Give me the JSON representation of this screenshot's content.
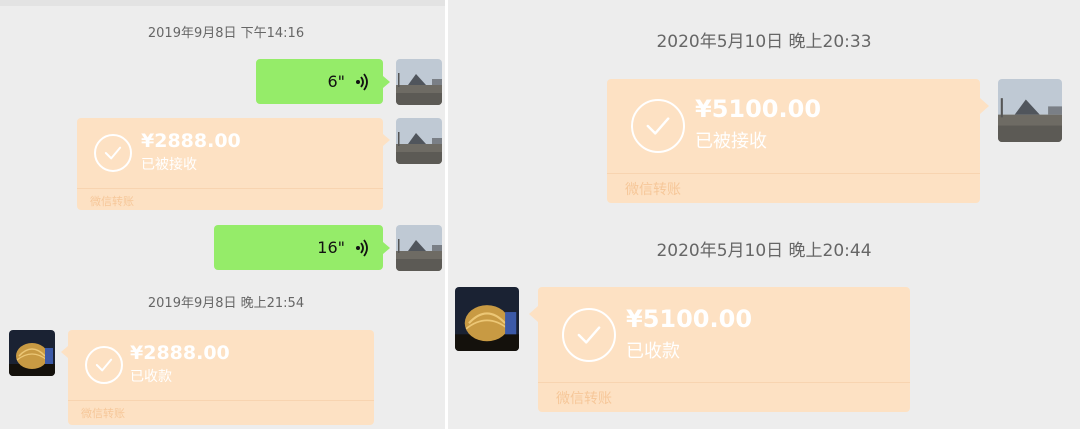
{
  "left": {
    "timestamp_1": "2019年9月8日 下午14:16",
    "voice_1": {
      "duration": "6\"",
      "wave_icon": "voice-wave-icon"
    },
    "transfer_1": {
      "amount": "¥2888.00",
      "status": "已被接收",
      "footer": "微信转账"
    },
    "voice_2": {
      "duration": "16\"",
      "wave_icon": "voice-wave-icon"
    },
    "timestamp_2": "2019年9月8日 晚上21:54",
    "transfer_2": {
      "amount": "¥2888.00",
      "status": "已收款",
      "footer": "微信转账"
    }
  },
  "right": {
    "timestamp_1": "2020年5月10日 晚上20:33",
    "transfer_1": {
      "amount": "¥5100.00",
      "status": "已被接收",
      "footer": "微信转账"
    },
    "timestamp_2": "2020年5月10日 晚上20:44",
    "transfer_2": {
      "amount": "¥5100.00",
      "status": "已收款",
      "footer": "微信转账"
    }
  },
  "colors": {
    "chat_background": "#ededed",
    "voice_bubble": "#95ec69",
    "transfer_bubble": "#fde1c3",
    "timestamp_text": "#666666"
  }
}
